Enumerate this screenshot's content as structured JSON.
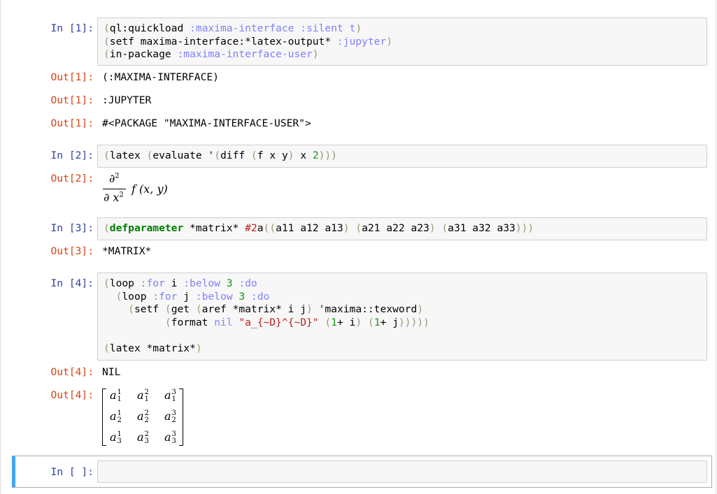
{
  "cells": {
    "c1": {
      "in_prompt": "In [1]:",
      "lines": [
        "(ql:quickload :maxima-interface :silent t)",
        "(setf maxima-interface:*latex-output* :jupyter)",
        "(in-package :maxima-interface-user)"
      ],
      "outputs": [
        {
          "prompt": "Out[1]:",
          "text": "(:MAXIMA-INTERFACE)"
        },
        {
          "prompt": "Out[1]:",
          "text": ":JUPYTER"
        },
        {
          "prompt": "Out[1]:",
          "text": "#<PACKAGE \"MAXIMA-INTERFACE-USER\">"
        }
      ]
    },
    "c2": {
      "in_prompt": "In [2]:",
      "lines": [
        "(latex (evaluate '(diff (f x y) x 2)))"
      ],
      "out_prompt": "Out[2]:",
      "math": {
        "numerator": "∂",
        "num_exp": "2",
        "denominator": "∂ x",
        "den_exp": "2",
        "rest": "f (x, y)"
      }
    },
    "c3": {
      "in_prompt": "In [3]:",
      "lines": [
        "(defparameter *matrix* #2a((a11 a12 a13) (a21 a22 a23) (a31 a32 a33)))"
      ],
      "out_prompt": "Out[3]:",
      "out_text": "*MATRIX*"
    },
    "c4": {
      "in_prompt": "In [4]:",
      "lines": [
        "(loop :for i :below 3 :do",
        "  (loop :for j :below 3 :do",
        "    (setf (get (aref *matrix* i j) 'maxima::texword)",
        "          (format nil \"a_{~D}^{~D}\" (1+ i) (1+ j)))))",
        "",
        "(latex *matrix*)"
      ],
      "out_prompt_1": "Out[4]:",
      "out_text_1": "NIL",
      "out_prompt_2": "Out[4]:",
      "matrix": [
        [
          {
            "base": "a",
            "sub": "1",
            "sup": "1"
          },
          {
            "base": "a",
            "sub": "1",
            "sup": "2"
          },
          {
            "base": "a",
            "sub": "1",
            "sup": "3"
          }
        ],
        [
          {
            "base": "a",
            "sub": "2",
            "sup": "1"
          },
          {
            "base": "a",
            "sub": "2",
            "sup": "2"
          },
          {
            "base": "a",
            "sub": "2",
            "sup": "3"
          }
        ],
        [
          {
            "base": "a",
            "sub": "3",
            "sup": "1"
          },
          {
            "base": "a",
            "sub": "3",
            "sup": "2"
          },
          {
            "base": "a",
            "sub": "3",
            "sup": "3"
          }
        ]
      ]
    },
    "c5": {
      "in_prompt": "In [ ]:"
    }
  },
  "colors": {
    "in_prompt": "#303f9f",
    "out_prompt": "#d84315",
    "keyword_symbol": "#7f7fff",
    "number": "#119911",
    "string": "#ba2121",
    "paren": "#999977",
    "special_form": "#008000",
    "active_cell_marker": "#42a5f5"
  }
}
